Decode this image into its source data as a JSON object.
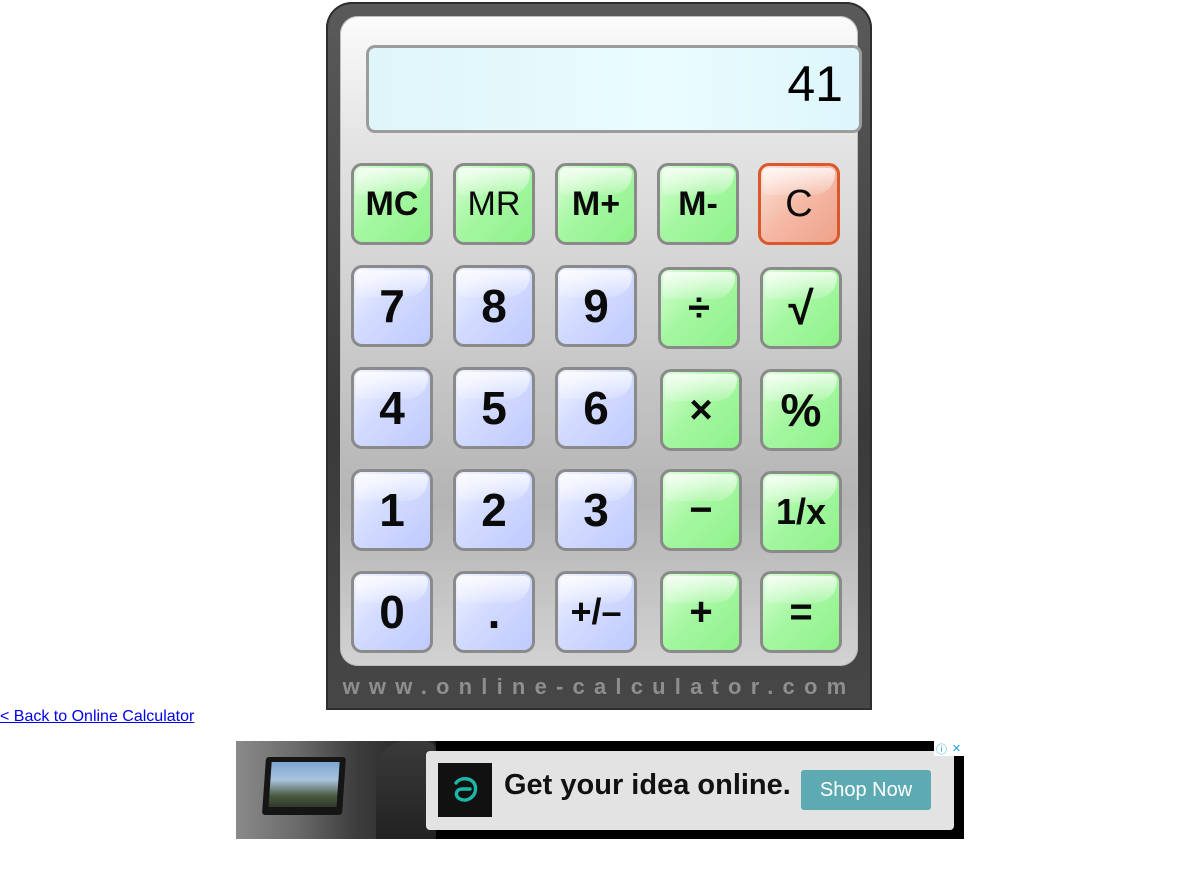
{
  "display": {
    "value": "41"
  },
  "keys": {
    "row1": [
      "MC",
      "MR",
      "M+",
      "M-",
      "C"
    ],
    "row2": [
      "7",
      "8",
      "9",
      "÷",
      "√"
    ],
    "row3": [
      "4",
      "5",
      "6",
      "×",
      "%"
    ],
    "row4": [
      "1",
      "2",
      "3",
      "−",
      "1/x"
    ],
    "row5": [
      "0",
      ".",
      "+/–",
      "+",
      "="
    ]
  },
  "brand": "www.online-calculator.com",
  "back_link": "< Back to Online Calculator",
  "ad": {
    "headline": "Get your idea online.",
    "cta": "Shop Now",
    "choices_icon": "ⓘ",
    "close_icon": "✕"
  },
  "colors": {
    "memory_and_operator_keys": "#a6f7a2",
    "number_keys": "#d2dbff",
    "clear_key": "#f5b9a5",
    "display": "#e3f9fd",
    "cta": "#5eaab3"
  }
}
